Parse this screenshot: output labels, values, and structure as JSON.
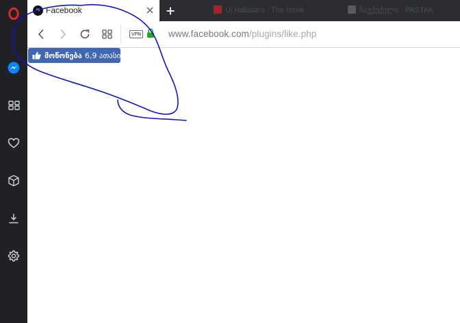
{
  "browser": {
    "tab": {
      "title": "Facebook",
      "favicon": "∞"
    },
    "ghost_tabs": [
      {
        "label": "Uj Halasaro · The Issue",
        "accent": "#a0262c"
      },
      {
        "label": "ჩაუქუქელი · PASTAK",
        "accent": "#5b5b5b"
      }
    ],
    "address": {
      "vpn_label": "VPN",
      "url_host": "www.facebook.com",
      "url_path": "/plugins/like.php"
    }
  },
  "like_button": {
    "label": "მოწონება",
    "count": "6,9 ათასი"
  },
  "colors": {
    "sidebar": "#1f2124",
    "opera_red": "#e3262b",
    "messenger_blue": "#0a84ff",
    "facebook_blue": "#4267b2",
    "ink_annotation": "#1010c8",
    "lock_green": "#1fa81f"
  }
}
